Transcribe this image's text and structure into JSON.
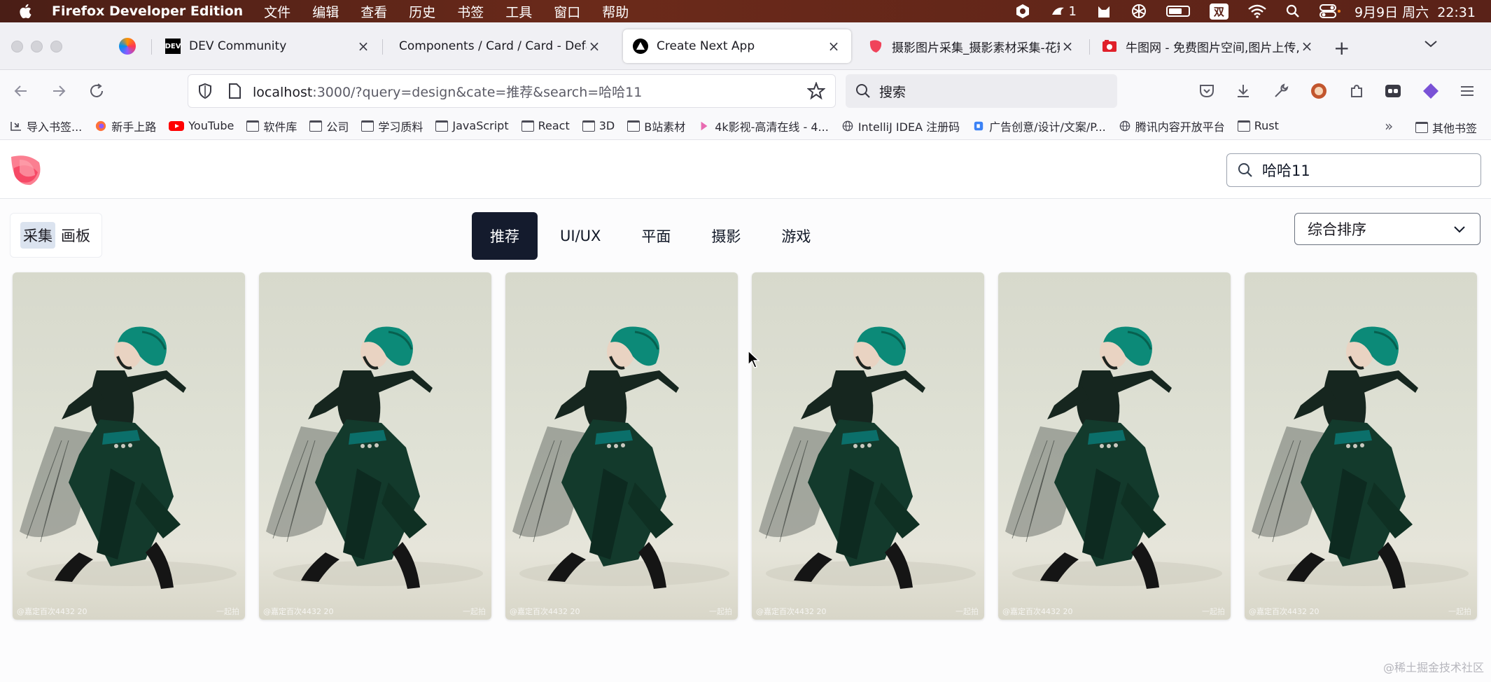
{
  "menubar": {
    "app_name": "Firefox Developer Edition",
    "items": [
      "文件",
      "编辑",
      "查看",
      "历史",
      "书签",
      "工具",
      "窗口",
      "帮助"
    ],
    "notif_count": "1",
    "ime": "双",
    "clock": "9月9日 周六  22:31"
  },
  "tabs": [
    {
      "title": "DEV Community",
      "favicon": "DEV"
    },
    {
      "title": "Components / Card / Card - Default",
      "favicon": ""
    },
    {
      "title": "Create Next App",
      "favicon": "triangle"
    },
    {
      "title": "摄影图片采集_摄影素材采集-花瓣",
      "favicon": "petal"
    },
    {
      "title": "牛图网 - 免费图片空间,图片上传,",
      "favicon": "camera"
    }
  ],
  "nav": {
    "url_host": "localhost",
    "url_rest": ":3000/?query=design&cate=推荐&search=哈哈11",
    "search_placeholder": "搜索"
  },
  "bookmarks": [
    {
      "label": "导入书签...",
      "icon": "import-icon"
    },
    {
      "label": "新手上路",
      "icon": "firefox-icon"
    },
    {
      "label": "YouTube",
      "icon": "youtube-icon"
    },
    {
      "label": "软件库",
      "icon": "folder-icon"
    },
    {
      "label": "公司",
      "icon": "folder-icon"
    },
    {
      "label": "学习质料",
      "icon": "folder-icon"
    },
    {
      "label": "JavaScript",
      "icon": "folder-icon"
    },
    {
      "label": "React",
      "icon": "folder-icon"
    },
    {
      "label": "3D",
      "icon": "folder-icon"
    },
    {
      "label": "B站素材",
      "icon": "folder-icon"
    },
    {
      "label": "4k影视-高清在线 - 4...",
      "icon": "movie-icon"
    },
    {
      "label": "IntelliJ IDEA 注册码",
      "icon": "globe-icon"
    },
    {
      "label": "广告创意/设计/文案/P...",
      "icon": "ad-icon"
    },
    {
      "label": "腾讯内容开放平台",
      "icon": "globe-icon"
    },
    {
      "label": "Rust",
      "icon": "folder-icon"
    }
  ],
  "bookmarks_other": "其他书签",
  "page": {
    "search_value": "哈哈11",
    "segments": [
      {
        "label": "采集",
        "active": true
      },
      {
        "label": "画板",
        "active": false
      }
    ],
    "categories": [
      {
        "label": "推荐",
        "active": true
      },
      {
        "label": "UI/UX",
        "active": false
      },
      {
        "label": "平面",
        "active": false
      },
      {
        "label": "摄影",
        "active": false
      },
      {
        "label": "游戏",
        "active": false
      }
    ],
    "sort_label": "综合排序",
    "cards": [
      {
        "wm_left": "@嘉定百次4432 20",
        "wm_right": "一起拍"
      },
      {
        "wm_left": "@嘉定百次4432 20",
        "wm_right": "一起拍"
      },
      {
        "wm_left": "@嘉定百次4432 20",
        "wm_right": "一起拍"
      },
      {
        "wm_left": "@嘉定百次4432 20",
        "wm_right": "一起拍"
      },
      {
        "wm_left": "@嘉定百次4432 20",
        "wm_right": "一起拍"
      },
      {
        "wm_left": "@嘉定百次4432 20",
        "wm_right": "一起拍"
      }
    ],
    "site_watermark": "@稀土掘金技术社区"
  },
  "colors": {
    "accent_active_category": "#141b2d",
    "segment_active": "#dbe3ef",
    "brand_logo": "#f43f5e"
  }
}
